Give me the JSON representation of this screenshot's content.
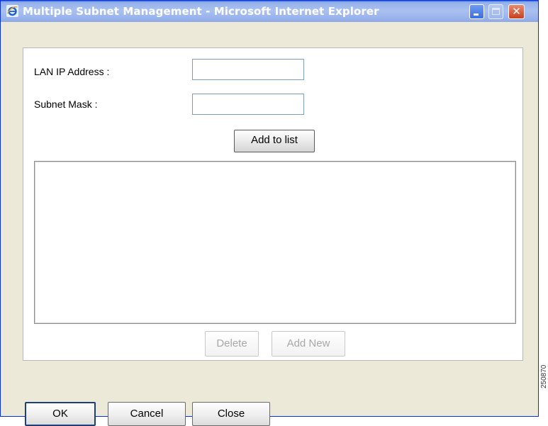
{
  "window": {
    "title": "Multiple Subnet Management - Microsoft Internet Explorer"
  },
  "form": {
    "lan_ip_label": "LAN IP Address :",
    "lan_ip_value": "",
    "subnet_mask_label": "Subnet Mask :",
    "subnet_mask_value": "",
    "add_to_list_label": "Add to list",
    "list_items": [],
    "delete_label": "Delete",
    "add_new_label": "Add New"
  },
  "footer": {
    "ok_label": "OK",
    "cancel_label": "Cancel",
    "close_label": "Close"
  },
  "side_mark": "250870",
  "icons": {
    "app": "internet-explorer-icon",
    "minimize": "minimize-icon",
    "maximize": "maximize-icon",
    "close": "close-icon"
  },
  "colors": {
    "titlebar": "#94b1ea",
    "window_bg": "#ece9d8",
    "close_button": "#c6411e"
  }
}
